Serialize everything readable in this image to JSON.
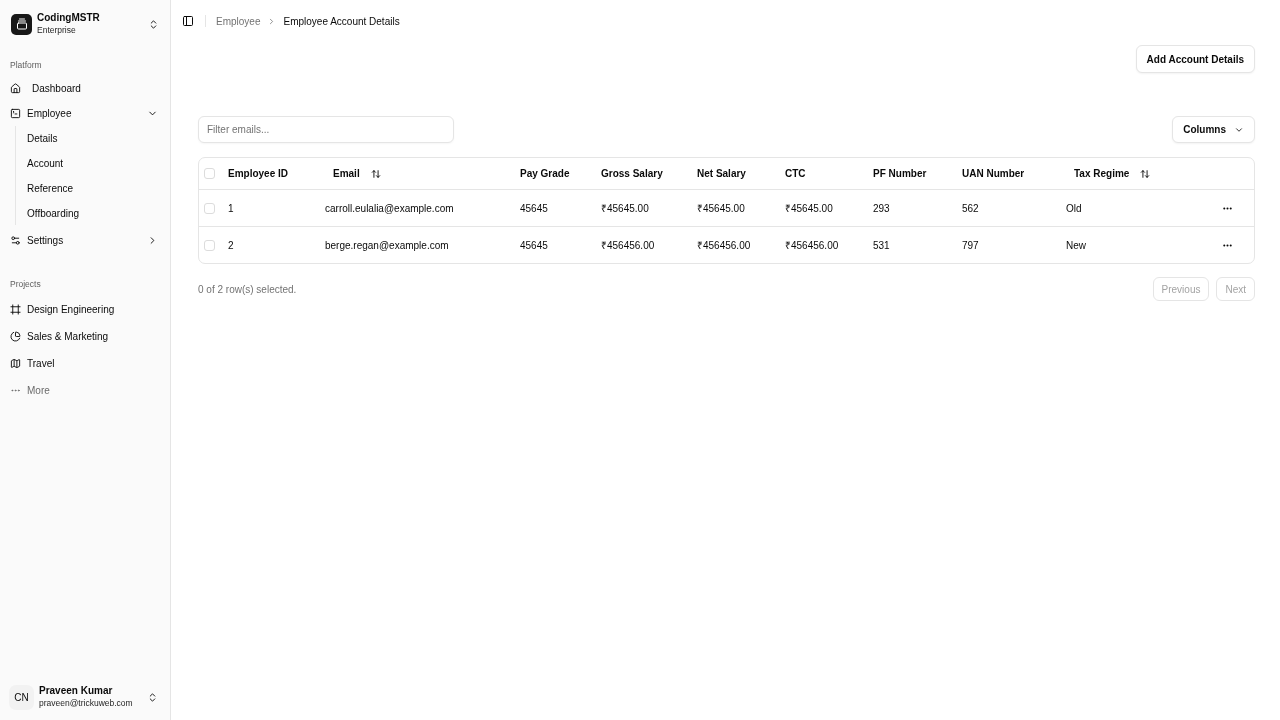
{
  "sidebar": {
    "team": {
      "name": "CodingMSTR",
      "plan": "Enterprise"
    },
    "groups": [
      {
        "label": "Platform",
        "items": [
          {
            "label": "Dashboard",
            "kind": "link"
          },
          {
            "label": "Employee",
            "kind": "group",
            "expanded": true,
            "children": [
              {
                "label": "Details"
              },
              {
                "label": "Account"
              },
              {
                "label": "Reference"
              },
              {
                "label": "Offboarding"
              }
            ]
          },
          {
            "label": "Settings",
            "kind": "group",
            "expanded": false
          }
        ]
      },
      {
        "label": "Projects",
        "items": [
          {
            "label": "Design Engineering",
            "kind": "project"
          },
          {
            "label": "Sales & Marketing",
            "kind": "project"
          },
          {
            "label": "Travel",
            "kind": "project"
          },
          {
            "label": "More",
            "kind": "more"
          }
        ]
      }
    ],
    "user": {
      "initials": "CN",
      "name": "Praveen Kumar",
      "email": "praveen@trickuweb.com"
    }
  },
  "breadcrumb": [
    {
      "label": "Employee",
      "current": false
    },
    {
      "label": "Employee Account Details",
      "current": true
    }
  ],
  "add_button": "Add Account Details",
  "filter": {
    "placeholder": "Filter emails..."
  },
  "columns_button": "Columns",
  "table": {
    "select_all": {
      "checked": false
    },
    "columns": [
      {
        "label": "Employee ID",
        "sortable": false
      },
      {
        "label": "Email",
        "sortable": true
      },
      {
        "label": "Pay Grade",
        "sortable": false
      },
      {
        "label": "Gross Salary",
        "sortable": false
      },
      {
        "label": "Net Salary",
        "sortable": false
      },
      {
        "label": "CTC",
        "sortable": false
      },
      {
        "label": "PF Number",
        "sortable": false
      },
      {
        "label": "UAN Number",
        "sortable": false
      },
      {
        "label": "Tax Regime",
        "sortable": true
      }
    ],
    "rows": [
      {
        "selected": false,
        "cells": [
          "1",
          "carroll.eulalia@example.com",
          "45645",
          "₹45645.00",
          "₹45645.00",
          "₹45645.00",
          "293",
          "562",
          "Old"
        ]
      },
      {
        "selected": false,
        "cells": [
          "2",
          "berge.regan@example.com",
          "45645",
          "₹456456.00",
          "₹456456.00",
          "₹456456.00",
          "531",
          "797",
          "New"
        ]
      }
    ]
  },
  "selection_summary": "0 of 2 row(s) selected.",
  "pagination": [
    {
      "label": "Previous",
      "disabled": true
    },
    {
      "label": "Next",
      "disabled": true
    }
  ]
}
